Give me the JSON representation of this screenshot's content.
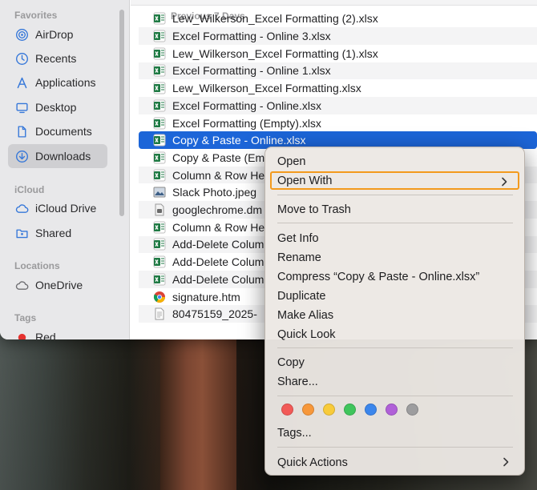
{
  "sidebar": {
    "favorites_header": "Favorites",
    "icloud_header": "iCloud",
    "locations_header": "Locations",
    "tags_header": "Tags",
    "items": [
      {
        "label": "AirDrop",
        "icon": "airdrop-icon"
      },
      {
        "label": "Recents",
        "icon": "clock-icon"
      },
      {
        "label": "Applications",
        "icon": "applications-icon"
      },
      {
        "label": "Desktop",
        "icon": "desktop-icon"
      },
      {
        "label": "Documents",
        "icon": "document-icon"
      },
      {
        "label": "Downloads",
        "icon": "downloads-icon",
        "selected": true
      },
      {
        "label": "iCloud Drive",
        "icon": "cloud-icon"
      },
      {
        "label": "Shared",
        "icon": "shared-folder-icon"
      },
      {
        "label": "OneDrive",
        "icon": "cloud-icon"
      },
      {
        "label": "Red",
        "icon": "tag-dot-icon",
        "color": "#e5322f"
      }
    ]
  },
  "file_list": {
    "group_header": "Previous 7 Days",
    "files": [
      {
        "name": "Lew_Wilkerson_Excel Formatting (2).xlsx",
        "icon": "excel-icon"
      },
      {
        "name": "Excel Formatting - Online 3.xlsx",
        "icon": "excel-icon"
      },
      {
        "name": "Lew_Wilkerson_Excel Formatting (1).xlsx",
        "icon": "excel-icon"
      },
      {
        "name": "Excel Formatting - Online 1.xlsx",
        "icon": "excel-icon"
      },
      {
        "name": "Lew_Wilkerson_Excel Formatting.xlsx",
        "icon": "excel-icon"
      },
      {
        "name": "Excel Formatting - Online.xlsx",
        "icon": "excel-icon"
      },
      {
        "name": "Excel Formatting (Empty).xlsx",
        "icon": "excel-icon"
      },
      {
        "name": "Copy & Paste - Online.xlsx",
        "icon": "excel-icon",
        "selected": true
      },
      {
        "name": "Copy & Paste (Em",
        "icon": "excel-icon"
      },
      {
        "name": "Column & Row He",
        "icon": "excel-icon"
      },
      {
        "name": "Slack Photo.jpeg",
        "icon": "image-icon"
      },
      {
        "name": "googlechrome.dm",
        "icon": "disk-image-icon"
      },
      {
        "name": "Column & Row He",
        "icon": "excel-icon"
      },
      {
        "name": "Add-Delete Colum",
        "icon": "excel-icon"
      },
      {
        "name": "Add-Delete Colum",
        "icon": "excel-icon"
      },
      {
        "name": "Add-Delete Colum",
        "icon": "excel-icon"
      },
      {
        "name": "signature.htm",
        "icon": "chrome-icon"
      },
      {
        "name": "80475159_2025-",
        "icon": "document-icon"
      }
    ]
  },
  "context_menu": {
    "open": "Open",
    "open_with": "Open With",
    "move_to_trash": "Move to Trash",
    "get_info": "Get Info",
    "rename": "Rename",
    "compress": "Compress “Copy & Paste - Online.xlsx”",
    "duplicate": "Duplicate",
    "make_alias": "Make Alias",
    "quick_look": "Quick Look",
    "copy": "Copy",
    "share": "Share...",
    "tags": "Tags...",
    "quick_actions": "Quick Actions",
    "tag_colors": [
      "#f25a57",
      "#f7983a",
      "#f8cb3a",
      "#3fc55c",
      "#3b86ec",
      "#b060d8",
      "#9d9d9f"
    ],
    "highlight_color": "#f39a1d"
  }
}
